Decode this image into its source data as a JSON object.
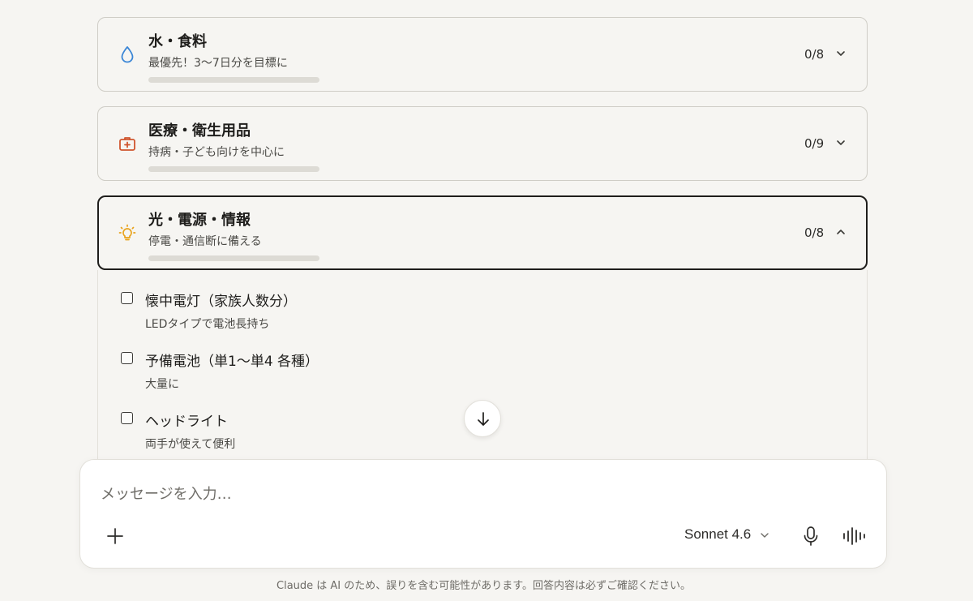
{
  "categories": [
    {
      "title": "水・食料",
      "subtitle": "最優先！3〜7日分を目標に",
      "count": "0/8",
      "progress": 0,
      "icon": "water-drop-icon",
      "icon_color": "#3a86d6",
      "expanded": false
    },
    {
      "title": "医療・衛生用品",
      "subtitle": "持病・子ども向けを中心に",
      "count": "0/9",
      "progress": 0,
      "icon": "first-aid-kit-icon",
      "icon_color": "#d0552e",
      "expanded": false
    },
    {
      "title": "光・電源・情報",
      "subtitle": "停電・通信断に備える",
      "count": "0/8",
      "progress": 0,
      "icon": "lightbulb-icon",
      "icon_color": "#e8a21a",
      "expanded": true
    }
  ],
  "items": [
    {
      "title": "懐中電灯（家族人数分）",
      "note": "LEDタイプで電池長持ち",
      "checked": false
    },
    {
      "title": "予備電池（単1〜単4 各種）",
      "note": "大量に",
      "checked": false
    },
    {
      "title": "ヘッドライト",
      "note": "両手が使えて便利",
      "checked": false
    }
  ],
  "composer": {
    "placeholder": "メッセージを入力…",
    "model": "Sonnet 4.6"
  },
  "disclaimer": "Claude は AI のため、誤りを含む可能性があります。回答内容は必ずご確認ください。"
}
